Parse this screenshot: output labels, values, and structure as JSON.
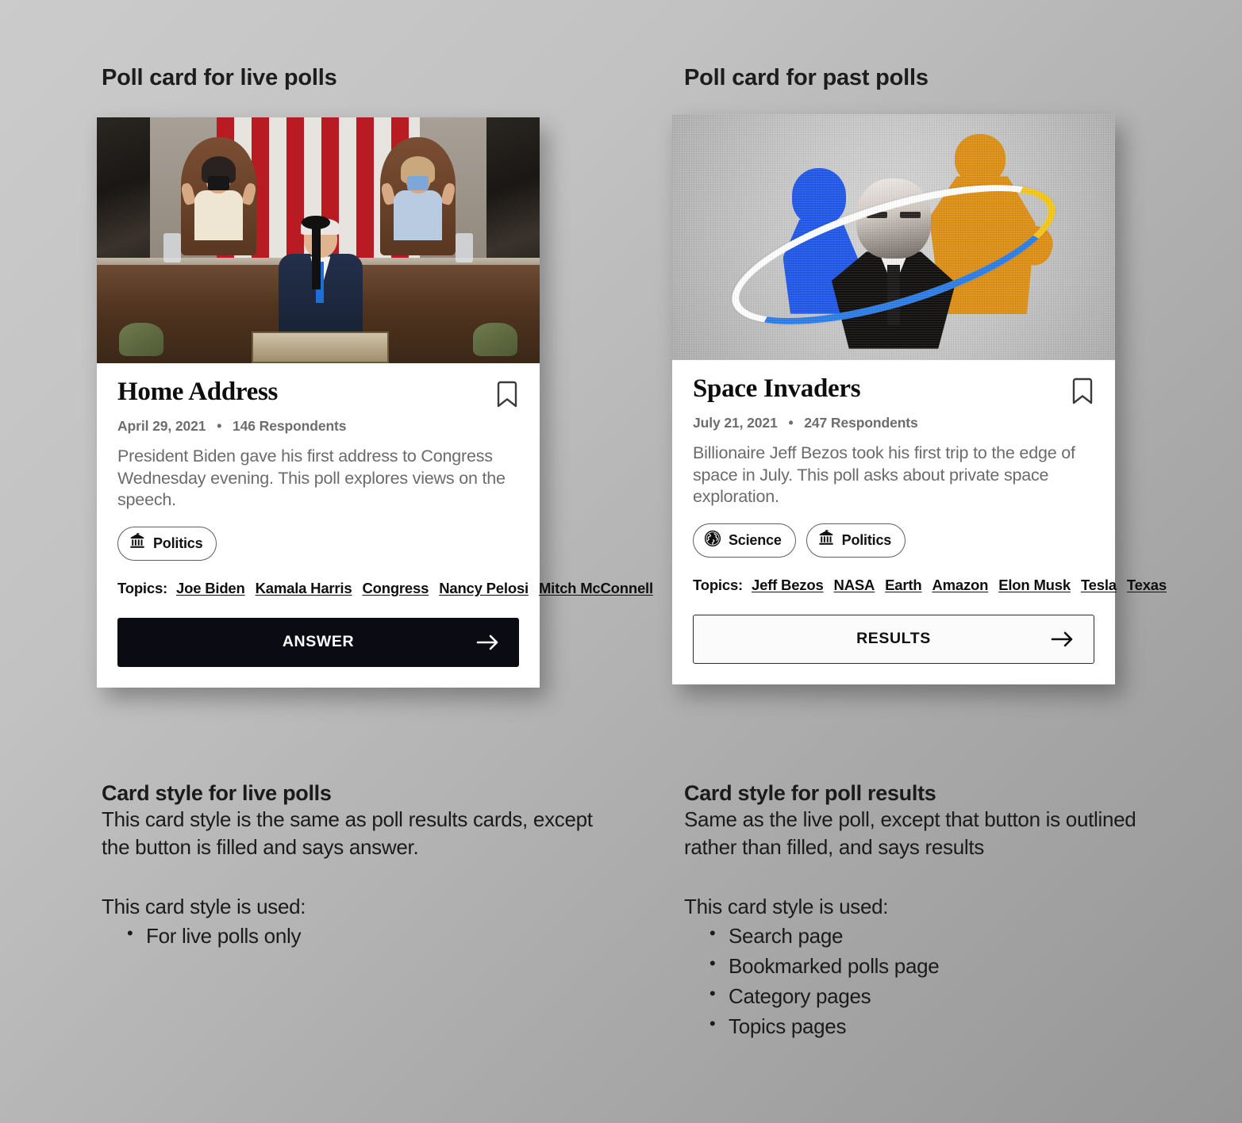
{
  "headings": {
    "live": "Poll card for live polls",
    "past": "Poll card for past polls"
  },
  "cards": {
    "live": {
      "image_alt": "President Biden addressing a joint session of Congress with Kamala Harris and Nancy Pelosi applauding behind him",
      "title": "Home Address",
      "date": "April 29, 2021",
      "separator": "•",
      "respondents": "146 Respondents",
      "description": "President Biden gave his first address to Congress Wednesday evening. This poll explores views on the speech.",
      "bookmark_icon": "bookmark-icon",
      "categories": [
        {
          "label": "Politics",
          "icon": "bank-icon"
        }
      ],
      "topics_label": "Topics:",
      "topics": [
        "Joe Biden",
        "Kamala Harris",
        "Congress",
        "Nancy Pelosi",
        "Mitch McConnell"
      ],
      "cta_label": "ANSWER",
      "cta_style": "filled",
      "cta_icon": "arrow-right-icon"
    },
    "past": {
      "image_alt": "Stylized collage of Jeff Bezos portraits in blue, orange and black and white with a white orbital ring",
      "title": "Space Invaders",
      "date": "July 21, 2021",
      "separator": "•",
      "respondents": "247 Respondents",
      "description": "Billionaire Jeff Bezos took his first trip to the edge of space in July. This poll asks about private space exploration.",
      "bookmark_icon": "bookmark-icon",
      "categories": [
        {
          "label": "Science",
          "icon": "globe-icon"
        },
        {
          "label": "Politics",
          "icon": "bank-icon"
        }
      ],
      "topics_label": "Topics:",
      "topics": [
        "Jeff Bezos",
        "NASA",
        "Earth",
        "Amazon",
        "Elon Musk",
        "Tesla",
        "Texas"
      ],
      "cta_label": "RESULTS",
      "cta_style": "outlined",
      "cta_icon": "arrow-right-icon"
    }
  },
  "captions": {
    "live": {
      "heading": "Card style for live polls",
      "body": "This card style is the same as poll results cards, except the button is filled and says answer.",
      "used_intro": "This card style is used:",
      "used_items": [
        "For live polls only"
      ]
    },
    "past": {
      "heading": "Card style for poll results",
      "body": "Same as the live poll, except that button is outlined rather than filled, and says results",
      "used_intro": "This card style is used:",
      "used_items": [
        "Search page",
        "Bookmarked polls page",
        "Category pages",
        "Topics pages"
      ]
    }
  },
  "colors": {
    "background_light": "#cbcbcb",
    "background_dark": "#969696",
    "card_surface": "#ffffff",
    "filled_button": "#0b0b14",
    "text_primary": "#101010",
    "text_muted": "#6b6b6b"
  }
}
